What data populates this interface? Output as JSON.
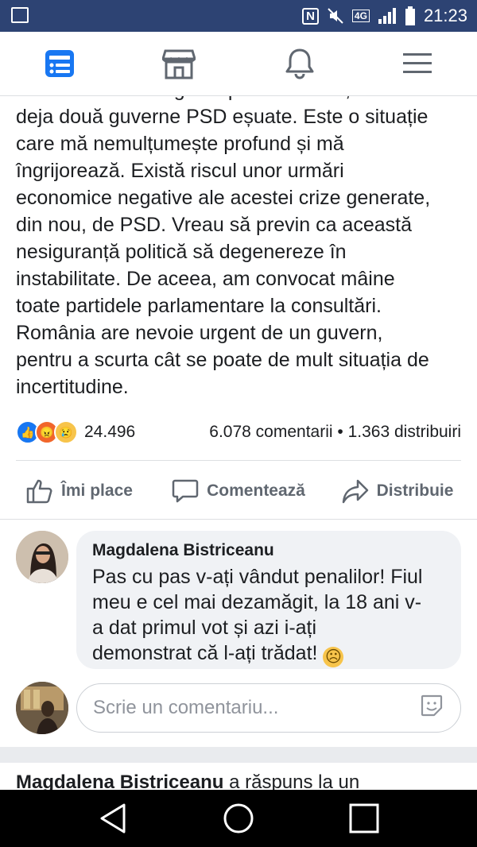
{
  "status_bar": {
    "time": "21:23",
    "network": "4G"
  },
  "top_nav": {
    "items": [
      "news-feed",
      "marketplace",
      "notifications",
      "menu"
    ]
  },
  "post": {
    "partial_first_line": "La un an de la alegerile parlamentare, avem",
    "lines": [
      "deja două guverne PSD eșuate. Este o situație",
      "care mă nemulțumește profund și mă",
      "îngrijorează. Există riscul unor urmări",
      "economice negative ale acestei crize generate,",
      "din nou, de PSD. Vreau să previn ca această",
      "nesiguranță politică să degenereze în",
      "instabilitate. De aceea, am convocat mâine",
      "toate partidele parlamentare la consultări.",
      "România are nevoie urgent de un guvern,",
      "pentru a scurta cât se poate de mult situația de",
      "incertitudine."
    ]
  },
  "stats": {
    "reactions_count": "24.496",
    "comments": "6.078 comentarii",
    "separator": "•",
    "shares": "1.363 distribuiri"
  },
  "actions": {
    "like": "Îmi place",
    "comment": "Comentează",
    "share": "Distribuie"
  },
  "comment": {
    "author": "Magdalena Bistriceanu",
    "lines": [
      "Pas cu pas v-ați vândut penalilor! Fiul",
      "meu e cel mai dezamăgit, la 18 ani v-",
      "a dat primul vot și azi i-ați",
      "demonstrat că l-ați trădat!"
    ],
    "emoji": "☹"
  },
  "composer": {
    "placeholder": "Scrie un comentariu..."
  },
  "reply_notice": {
    "author": "Magdalena Bistriceanu",
    "text": "a răspuns la un"
  },
  "colors": {
    "status_bar": "#2d4373",
    "brand_blue": "#1877f2",
    "gray_text": "#606770"
  }
}
